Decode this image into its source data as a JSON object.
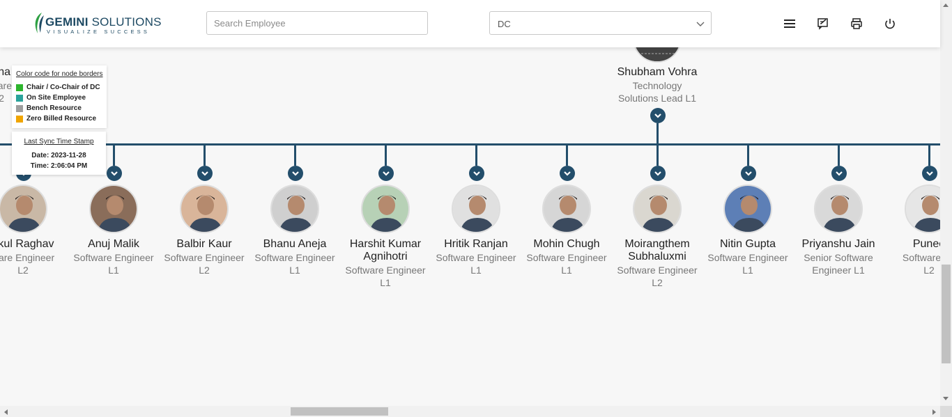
{
  "app": {
    "logo_main_bold": "GEMINI",
    "logo_main_rest": " SOLUTIONS",
    "logo_tagline": "VISUALIZE SUCCESS"
  },
  "search": {
    "placeholder": "Search Employee",
    "value": ""
  },
  "dc_select": {
    "value": "DC"
  },
  "toolbar_icons": [
    "menu-icon",
    "feedback-icon",
    "print-icon",
    "power-icon"
  ],
  "top_node": {
    "name": "Shubham Vohra",
    "role_line1": "Technology",
    "role_line2": "Solutions Lead L1"
  },
  "partial_left_node": {
    "name_fragment": "na",
    "role_fragment": "are",
    "level_fragment": "2"
  },
  "legend": {
    "title": "Color code for node borders",
    "items": [
      {
        "label": "Chair / Co-Chair of DC",
        "color": "#2db52d"
      },
      {
        "label": "On Site Employee",
        "color": "#2aa39b"
      },
      {
        "label": "Bench Resource",
        "color": "#9e9e9e"
      },
      {
        "label": "Zero Billed Resource",
        "color": "#f0a500"
      }
    ]
  },
  "sync": {
    "title": "Last Sync Time Stamp",
    "date": "Date: 2023-11-28",
    "time": "Time: 2:06:04 PM"
  },
  "employees": [
    {
      "name": "ukul Raghav",
      "role1": "ware Engineer",
      "role2": "L2",
      "role3": ""
    },
    {
      "name": "Anuj Malik",
      "role1": "Software Engineer",
      "role2": "L1",
      "role3": ""
    },
    {
      "name": "Balbir Kaur",
      "role1": "Software Engineer",
      "role2": "L2",
      "role3": ""
    },
    {
      "name": "Bhanu Aneja",
      "role1": "Software Engineer",
      "role2": "L1",
      "role3": ""
    },
    {
      "name": "Harshit Kumar\nAgnihotri",
      "role1": "Software Engineer",
      "role2": "L1",
      "role3": ""
    },
    {
      "name": "Hritik Ranjan",
      "role1": "Software Engineer",
      "role2": "L1",
      "role3": ""
    },
    {
      "name": "Mohin Chugh",
      "role1": "Software Engineer",
      "role2": "L1",
      "role3": ""
    },
    {
      "name": "Moirangthem\nSubhaluxmi",
      "role1": "Software Engineer",
      "role2": "L2",
      "role3": ""
    },
    {
      "name": "Nitin Gupta",
      "role1": "Software Engineer",
      "role2": "L1",
      "role3": ""
    },
    {
      "name": "Priyanshu Jain",
      "role1": "Senior Software",
      "role2": "Engineer L1",
      "role3": ""
    },
    {
      "name": "Punee",
      "role1": "Software En",
      "role2": "L2",
      "role3": ""
    }
  ],
  "colors": {
    "line": "#234e6b",
    "accent": "#1e4a63"
  }
}
